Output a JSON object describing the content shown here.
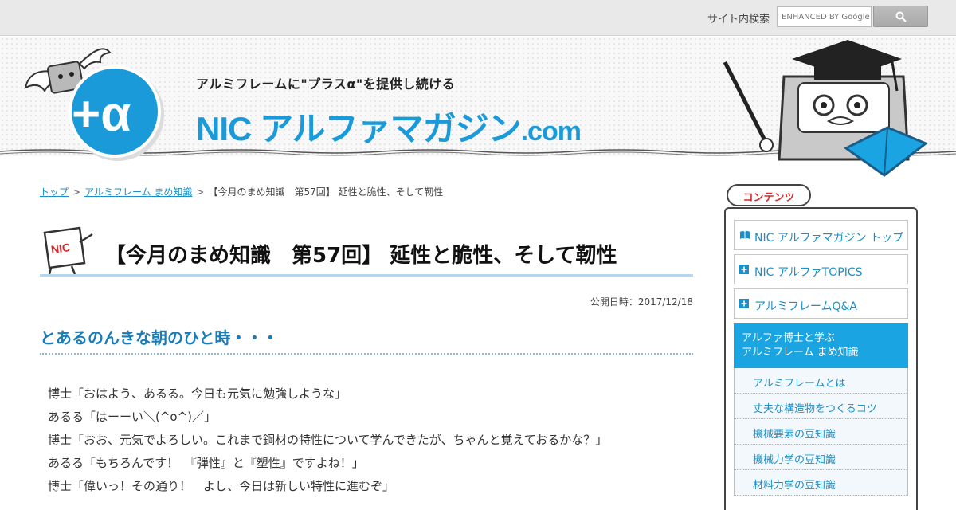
{
  "search": {
    "label": "サイト内検索",
    "placeholder": "ENHANCED BY Google"
  },
  "header": {
    "tagline": "アルミフレームに\"プラスα\"を提供し続ける",
    "site_name": "NIC アルファマガジン",
    "site_suffix": ".com"
  },
  "breadcrumb": {
    "items": [
      "トップ",
      "アルミフレーム まめ知識",
      "【今月のまめ知識　第57回】 延性と脆性、そして靭性"
    ],
    "separator": ">"
  },
  "article": {
    "title": "【今月のまめ知識　第57回】 延性と脆性、そして靭性",
    "title_badge": "NIC",
    "published": "公開日時：2017/12/18",
    "section_heading": "とあるのんきな朝のひと時・・・",
    "dialogue": [
      "博士「おはよう、あるる。今日も元気に勉強しような」",
      "あるる「はーーい＼(^o^)／」",
      "博士「おお、元気でよろしい。これまで鋼材の特性について学んできたが、ちゃんと覚えておるかな？」",
      "あるる「もちろんです！　『弾性』と『塑性』ですよね！」",
      "博士「偉いっ！その通り！　よし、今日は新しい特性に進むぞ」"
    ]
  },
  "sidebar": {
    "tab_label": "コンテンツ",
    "items": [
      {
        "label": "NIC アルファマガジン トップ",
        "icon": "book-icon"
      },
      {
        "label": "NIC アルファTOPICS",
        "icon": "plus-box-icon"
      },
      {
        "label": "アルミフレームQ&A",
        "icon": "plus-box-icon"
      }
    ],
    "active": {
      "line1": "アルファ博士と学ぶ",
      "line2": "アルミフレーム まめ知識"
    },
    "sub_items": [
      "アルミフレームとは",
      "丈夫な構造物をつくるコツ",
      "機械要素の豆知識",
      "機械力学の豆知識",
      "材料力学の豆知識"
    ]
  },
  "colors": {
    "brand_blue": "#1a9ad9",
    "accent_red": "#d6292a",
    "active_bg": "#1aa5e2"
  }
}
